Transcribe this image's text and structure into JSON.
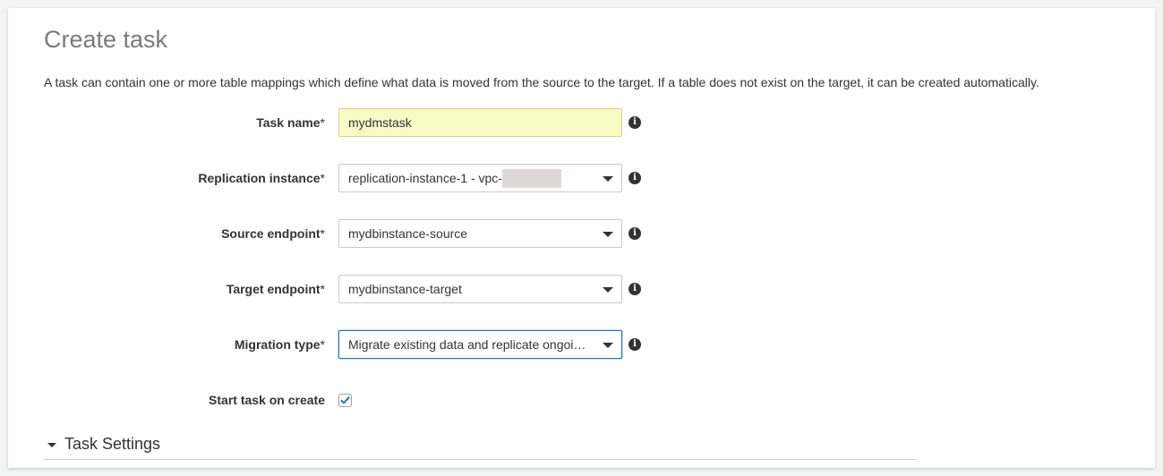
{
  "page": {
    "title": "Create task",
    "description": "A task can contain one or more table mappings which define what data is moved from the source to the target. If a table does not exist on the target, it can be created automatically."
  },
  "form": {
    "required_marker": "*",
    "task_name": {
      "label": "Task name",
      "value": "mydmstask"
    },
    "replication_instance": {
      "label": "Replication instance",
      "value": "replication-instance-1 - vpc-"
    },
    "source_endpoint": {
      "label": "Source endpoint",
      "value": "mydbinstance-source"
    },
    "target_endpoint": {
      "label": "Target endpoint",
      "value": "mydbinstance-target"
    },
    "migration_type": {
      "label": "Migration type",
      "value": "Migrate existing data and replicate ongoing changes"
    },
    "start_task_on_create": {
      "label": "Start task on create",
      "checked": true
    },
    "info_icon_glyph": "i"
  },
  "task_settings": {
    "label": "Task Settings"
  },
  "icons": {
    "info": "info-icon",
    "dropdown": "chevron-down-icon",
    "checkmark": "checkmark-icon",
    "section_toggle": "caret-down-icon"
  },
  "colors": {
    "task_name_fill": "#f9f9c6",
    "focus_border": "#1f72c4",
    "checkmark": "#1f72c4",
    "title": "#7a7a7a"
  }
}
